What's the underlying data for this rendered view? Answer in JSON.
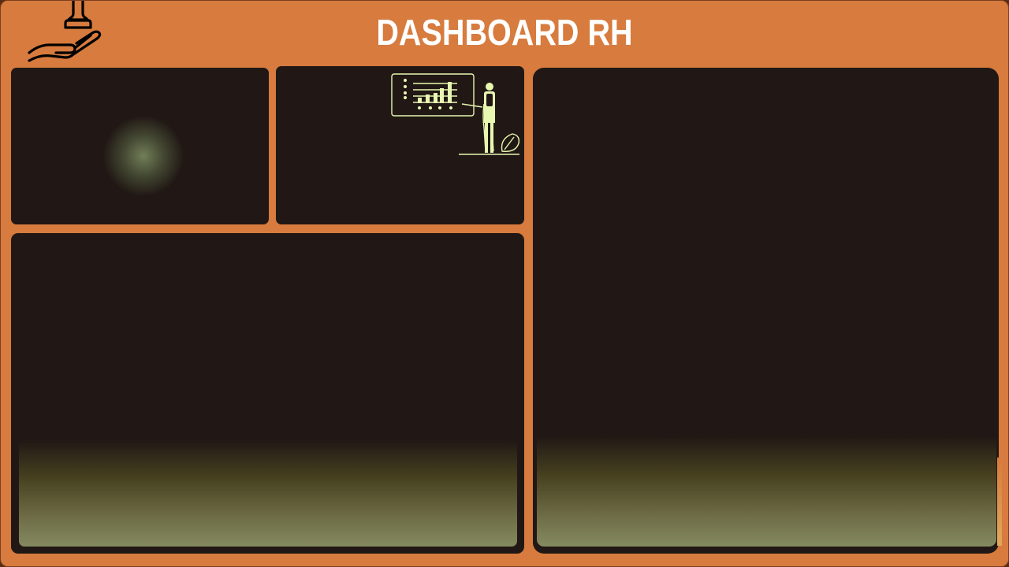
{
  "header": {
    "title": "DASHBOARD RH",
    "logo_icon": "hand-stamp-icon"
  },
  "panels": {
    "kpi_left": {
      "icon": "glow-spot"
    },
    "kpi_right": {
      "icon": "presenter-chart-illustration"
    },
    "bottom_left": {},
    "right_large": {}
  },
  "colors": {
    "background": "#d77b3e",
    "panel": "#211815",
    "accent": "#e8f7b0",
    "title": "#ffffff"
  }
}
